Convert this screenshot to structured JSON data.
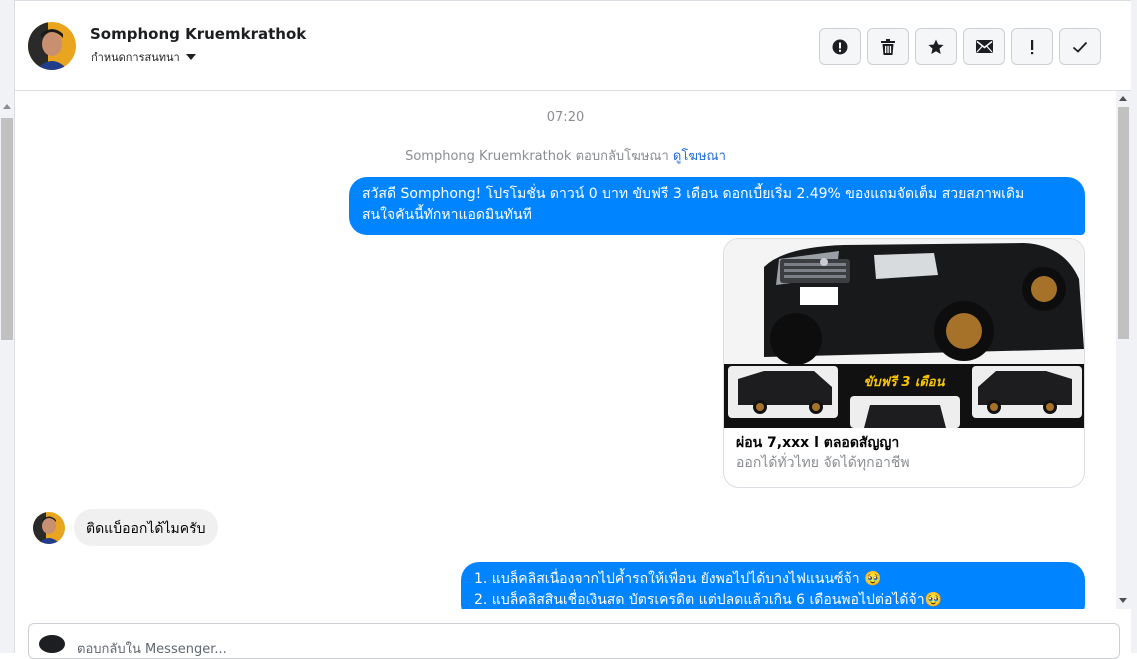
{
  "header": {
    "contact_name": "Somphong Kruemkrathok",
    "assign_label": "กำหนดการสนทนา",
    "actions": [
      {
        "icon": "alert-circle-icon"
      },
      {
        "icon": "trash-icon"
      },
      {
        "icon": "star-icon"
      },
      {
        "icon": "envelope-icon"
      },
      {
        "icon": "exclamation-icon"
      },
      {
        "icon": "checkmark-icon"
      }
    ]
  },
  "thread": {
    "timestamp": "07:20",
    "replied_text": "Somphong Kruemkrathok ตอบกลับโฆษณา",
    "replied_link": "ดูโฆษณา",
    "msg1_line1": "สวัสดี Somphong! โปรโมชั่น ดาวน์ 0 บาท ขับฟรี 3 เดือน ดอกเบี้ยเริ่ม 2.49% ของแถมจัดเต็ม สวยสภาพเดิม",
    "msg1_line2": "สนใจคันนี้ทักหาแอดมินทันที",
    "ad": {
      "banner_text": "ขับฟรี 3 เดือน",
      "title": "ผ่อน 7,xxx l ตลอดสัญญา",
      "subtitle": "ออกได้ทั่วไทย จัดได้ทุกอาชีพ"
    },
    "msg2": "ติดแบ็ออกได้ไมครับ",
    "msg3_line1": "1. แบล็คลิสเนื่องจากไปค้ำรถให้เพื่อน ยังพอไปได้บางไฟแนนซ์จ้า 🥹",
    "msg3_line2": "2. แบล็คลิสสินเชื่อเงินสด บัตรเครดิต แต่ปลดแล้วเกิน 6 เดือนพอไปต่อได้จ้า🥹"
  },
  "composer": {
    "placeholder": "ตอบกลับใน Messenger..."
  },
  "colors": {
    "accent": "#0084ff",
    "link": "#216fdb"
  }
}
